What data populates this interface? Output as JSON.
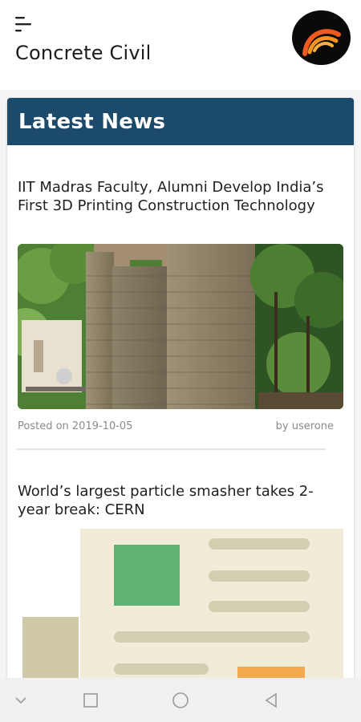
{
  "app": {
    "title": "Concrete Civil"
  },
  "icons": {
    "menu": "menu-icon",
    "logo": "logo-icon"
  },
  "section": {
    "title": "Latest News"
  },
  "articles": [
    {
      "title": "IIT Madras Faculty, Alumni Develop India’s First 3D Printing Construction Technology",
      "posted": "Posted on 2019-10-05",
      "author": "by userone"
    },
    {
      "title": "World’s largest particle smasher takes 2-year break: CERN"
    }
  ],
  "nav": {
    "buttons": [
      "chevron-down-icon",
      "square-icon",
      "circle-icon",
      "back-triangle-icon"
    ]
  },
  "colors": {
    "header_bg": "#1c4a6b",
    "accent_logo": "#f08a1e",
    "placeholder_bg": "#f1ebd8",
    "placeholder_green": "#5fb472",
    "placeholder_orange": "#f3a94e"
  }
}
